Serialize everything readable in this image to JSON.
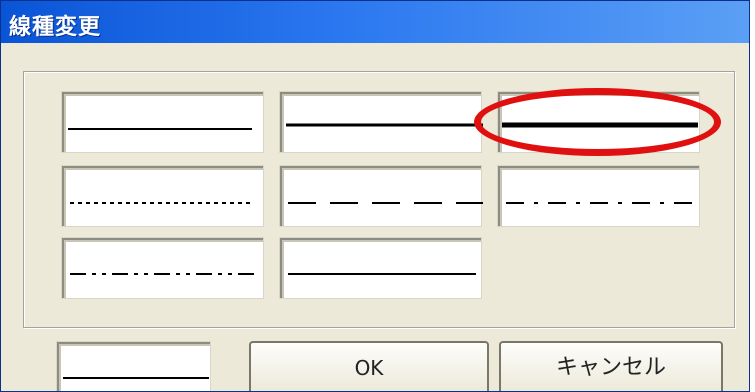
{
  "window": {
    "title": "線種変更"
  },
  "line_styles": [
    {
      "name": "thin-solid",
      "selected": false
    },
    {
      "name": "medium-solid",
      "selected": false
    },
    {
      "name": "thick-solid",
      "selected": true
    },
    {
      "name": "dotted",
      "selected": false
    },
    {
      "name": "dashed",
      "selected": false
    },
    {
      "name": "dash-dot",
      "selected": false
    },
    {
      "name": "dash-dot-dot",
      "selected": false
    },
    {
      "name": "solid-alt",
      "selected": false
    }
  ],
  "buttons": {
    "ok_label": "OK",
    "cancel_label": "キャンセル"
  },
  "colors": {
    "titlebar": "#0a55d6",
    "dialog_bg": "#ece9d8",
    "highlight": "#e01010",
    "line": "#000000"
  }
}
